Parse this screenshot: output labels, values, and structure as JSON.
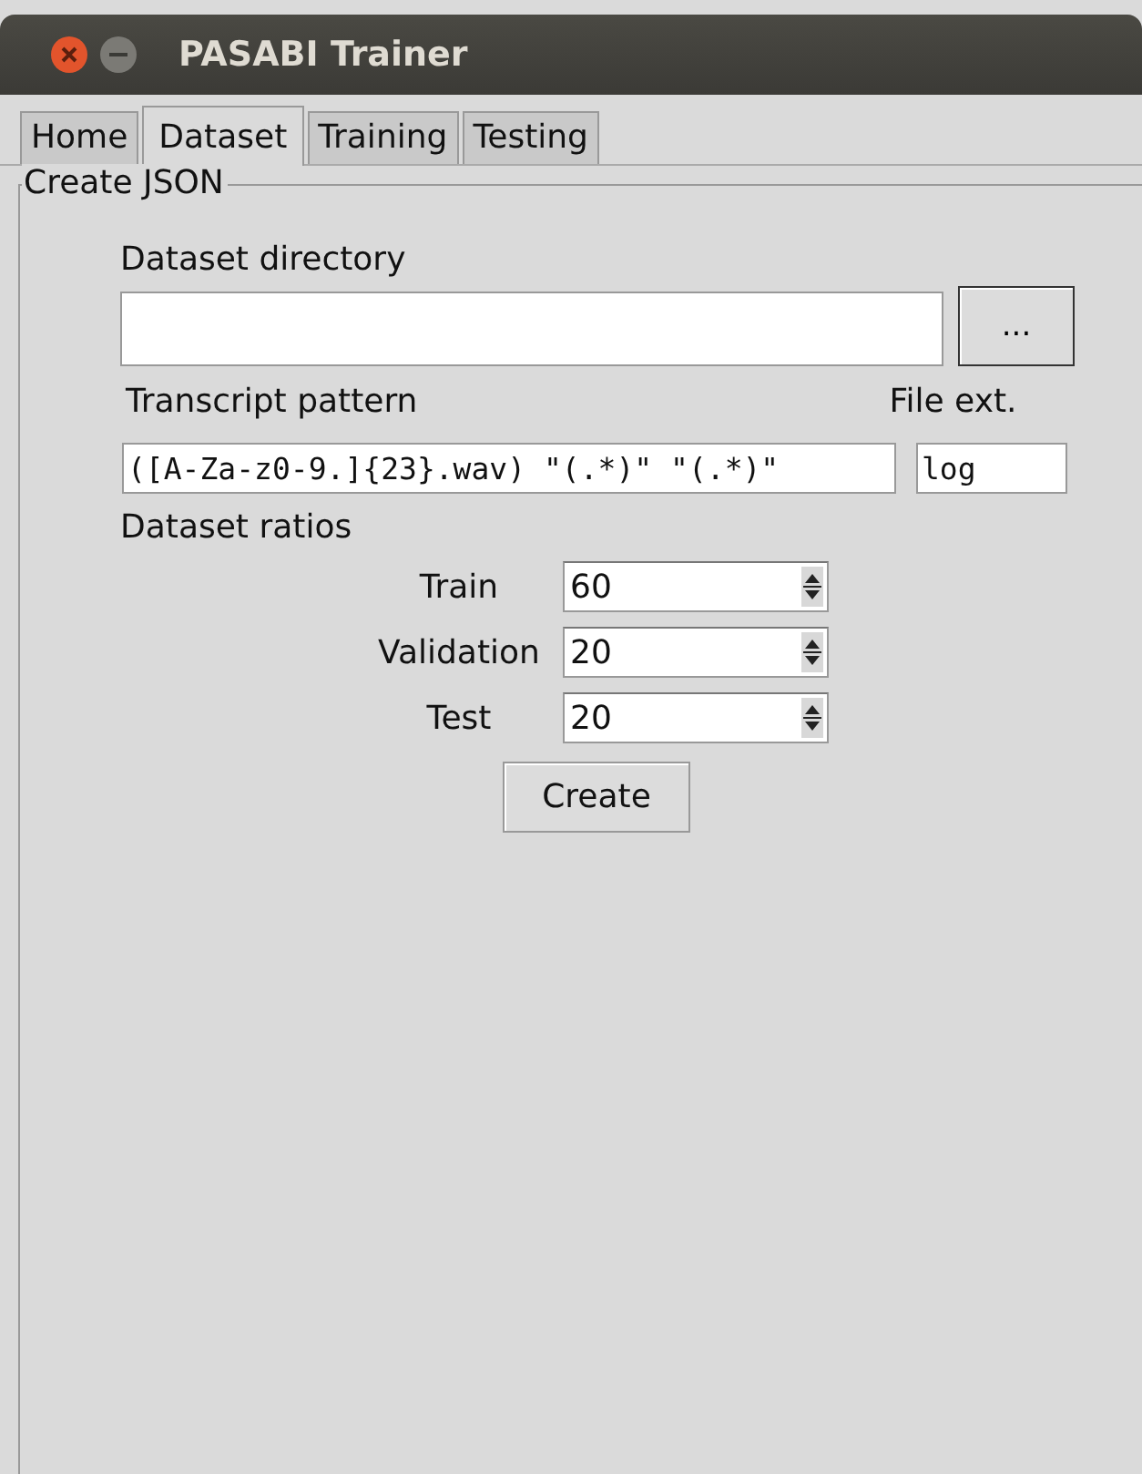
{
  "window": {
    "title": "PASABI Trainer"
  },
  "tabs": [
    {
      "label": "Home",
      "selected": false
    },
    {
      "label": "Dataset",
      "selected": true
    },
    {
      "label": "Training",
      "selected": false
    },
    {
      "label": "Testing",
      "selected": false
    }
  ],
  "group": {
    "title": "Create JSON"
  },
  "directory": {
    "label": "Dataset directory",
    "browse_button": "..."
  },
  "pattern": {
    "label": "Transcript pattern",
    "value": "([A-Za-z0-9.]{23}.wav) \"(.*)\" \"(.*)\""
  },
  "extension": {
    "label": "File ext.",
    "value": "log"
  },
  "ratios": {
    "label": "Dataset ratios",
    "items": [
      {
        "label": "Train",
        "value": "60"
      },
      {
        "label": "Validation",
        "value": "20"
      },
      {
        "label": "Test",
        "value": "20"
      }
    ]
  },
  "create_button": "Create"
}
